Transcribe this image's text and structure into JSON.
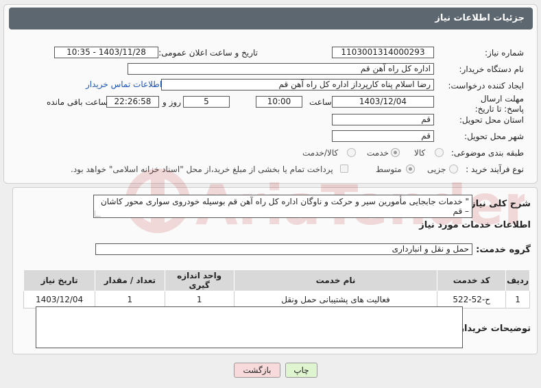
{
  "header": {
    "title": "جزئیات اطلاعات نیاز"
  },
  "form": {
    "need_number_label": "شماره نیاز:",
    "need_number": "1103001314000293",
    "announce_label": "تاریخ و ساعت اعلان عمومی:",
    "announce_value": "1403/11/28 - 10:35",
    "buyer_org_label": "نام دستگاه خریدار:",
    "buyer_org": "اداره کل  راه آهن قم",
    "creator_label": "ایجاد کننده درخواست:",
    "creator": "رضا اسلام پناه کارپرداز اداره کل  راه آهن قم",
    "contact_link": "اطلاعات تماس خریدار",
    "deadline_label": "مهلت ارسال پاسخ: تا تاریخ:",
    "deadline_date": "1403/12/04",
    "time_label": "ساعت",
    "deadline_time": "10:00",
    "days_value": "5",
    "days_label": "روز و",
    "remaining_time": "22:26:58",
    "remaining_label": "ساعت باقی مانده",
    "province_label": "استان محل تحویل:",
    "province": "قم",
    "city_label": "شهر محل تحویل:",
    "city": "قم",
    "category_label": "طبقه بندی موضوعی:",
    "category_options": [
      "کالا",
      "خدمت",
      "کالا/خدمت"
    ],
    "process_label": "نوع فرآیند خرید :",
    "process_options": [
      "جزیی",
      "متوسط"
    ],
    "payment_note": "پرداخت تمام یا بخشی از مبلغ خرید،از محل \"اسناد خزانه اسلامی\" خواهد بود."
  },
  "details": {
    "summary_label": "شرح کلی نیاز:",
    "summary": "\"  خدمات جابجایی مأمورین سیر و حرکت و ناوگان اداره کل راه آهن قم  بوسیله خودروی سواری محور کاشان – قم",
    "services_title": "اطلاعات خدمات مورد نیاز",
    "group_label": "گروه خدمت:",
    "group_value": "حمل و نقل و انبارداری",
    "table": {
      "headers": [
        "ردیف",
        "کد خدمت",
        "نام خدمت",
        "واحد اندازه گیری",
        "تعداد / مقدار",
        "تاریخ نیاز"
      ],
      "rows": [
        [
          "1",
          "ح-52-522",
          "فعالیت های پشتیبانی حمل ونقل",
          "1",
          "1",
          "1403/12/04"
        ]
      ]
    },
    "buyer_notes_label": "توضیحات خریدار:"
  },
  "buttons": {
    "print": "چاپ",
    "back": "بازگشت"
  },
  "watermark": {
    "text": "AriaTender.neT"
  },
  "colors": {
    "header": "#5c6770",
    "link": "#1a56b8",
    "print_bg": "#dff5d0",
    "back_bg": "#f9dada"
  }
}
